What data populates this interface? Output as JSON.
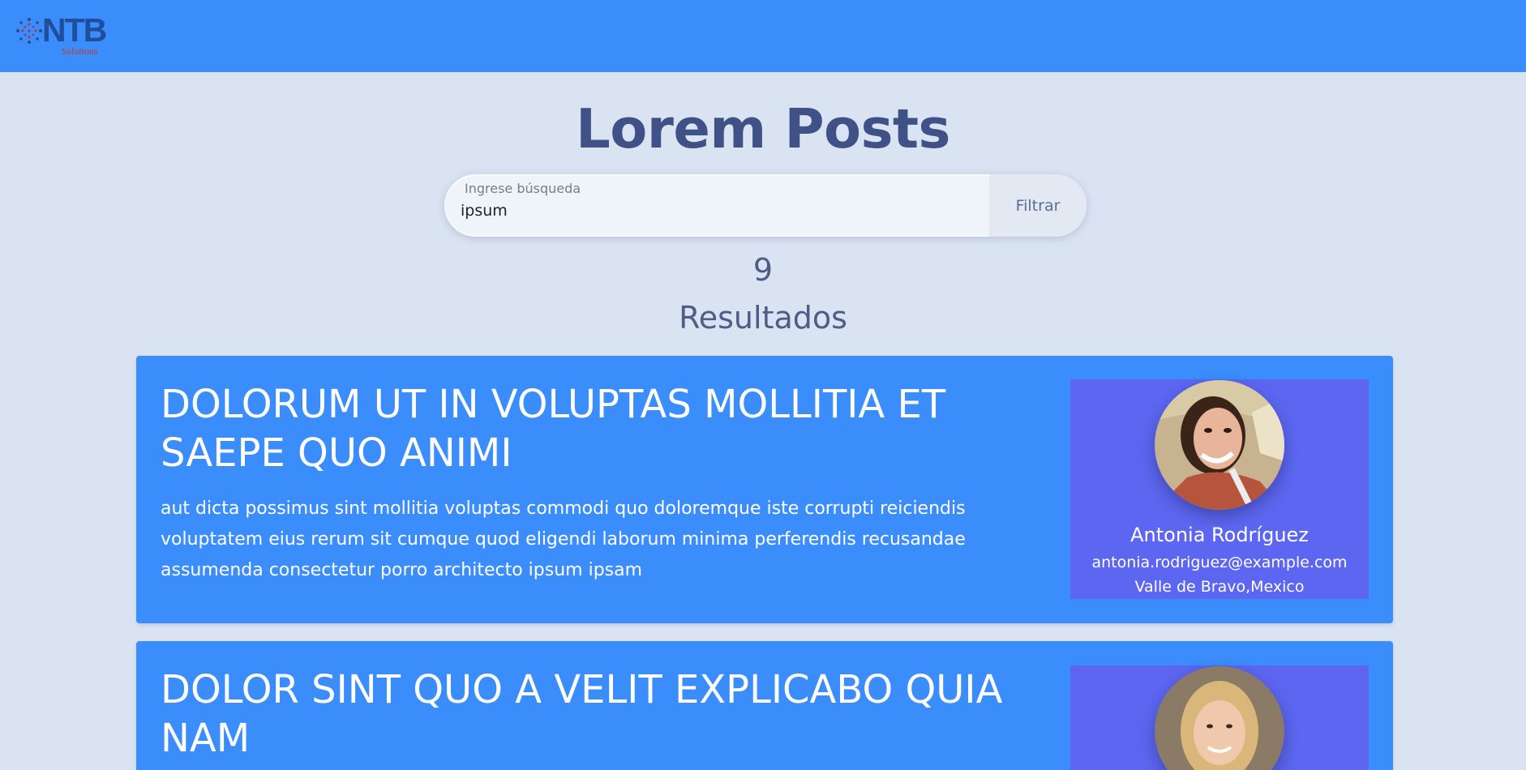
{
  "header": {
    "logo_text": "NTB",
    "logo_subtext": "Solutions"
  },
  "page": {
    "title": "Lorem Posts"
  },
  "search": {
    "label": "Ingrese búsqueda",
    "value": "ipsum",
    "button_label": "Filtrar"
  },
  "results": {
    "count": "9",
    "label": "Resultados"
  },
  "posts": [
    {
      "title": "DOLORUM UT IN VOLUPTAS MOLLITIA ET SAEPE QUO ANIMI",
      "body": "aut dicta possimus sint mollitia voluptas commodi quo doloremque iste corrupti reiciendis voluptatem eius rerum sit cumque quod eligendi laborum minima perferendis recusandae assumenda consectetur porro architecto ipsum ipsam",
      "author": {
        "name": "Antonia Rodríguez",
        "email": "antonia.rodriguez@example.com",
        "location": "Valle de Bravo,Mexico"
      }
    },
    {
      "title": "DOLOR SINT QUO A VELIT EXPLICABO QUIA NAM"
    }
  ],
  "colors": {
    "topbar": "#3b8dfb",
    "background": "#d9e3f2",
    "card": "#3a8dfb",
    "author_panel": "#5c66f0",
    "title_text": "#3f5186"
  },
  "icons": {
    "logo_mark": "starburst-logo-icon"
  }
}
